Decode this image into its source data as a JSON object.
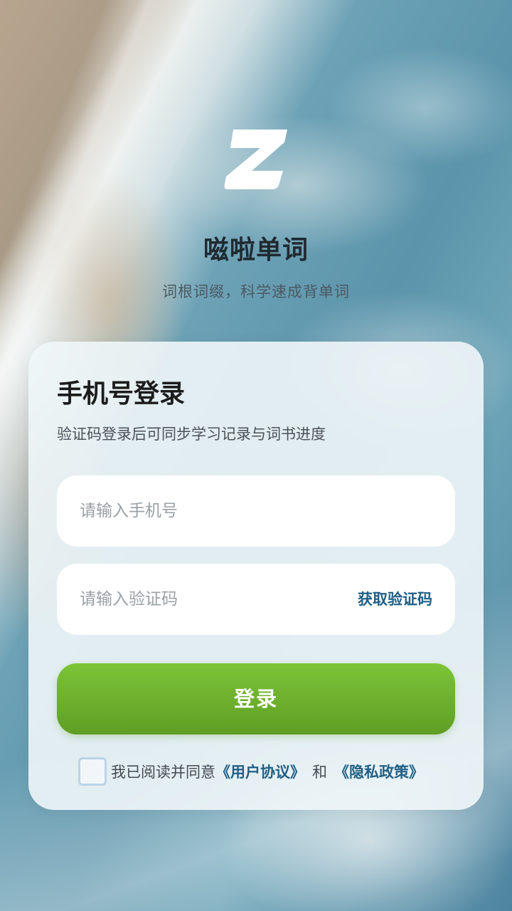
{
  "app": {
    "title": "嗞啦单词",
    "subtitle": "词根词缀，科学速成背单词",
    "logo_icon": "z-logo-icon"
  },
  "login": {
    "title": "手机号登录",
    "description": "验证码登录后可同步学习记录与词书进度",
    "phone_placeholder": "请输入手机号",
    "phone_value": "",
    "code_placeholder": "请输入验证码",
    "code_value": "",
    "get_code_label": "获取验证码",
    "submit_label": "登录"
  },
  "agreement": {
    "checked": false,
    "prefix": "我已阅读并同意",
    "user_agreement": "《用户协议》",
    "connector": "和",
    "privacy_policy": "《隐私政策》"
  },
  "colors": {
    "accent_green": "#6cb22e",
    "link_blue": "#1f5f86",
    "card_bg": "#f0f6f8"
  }
}
